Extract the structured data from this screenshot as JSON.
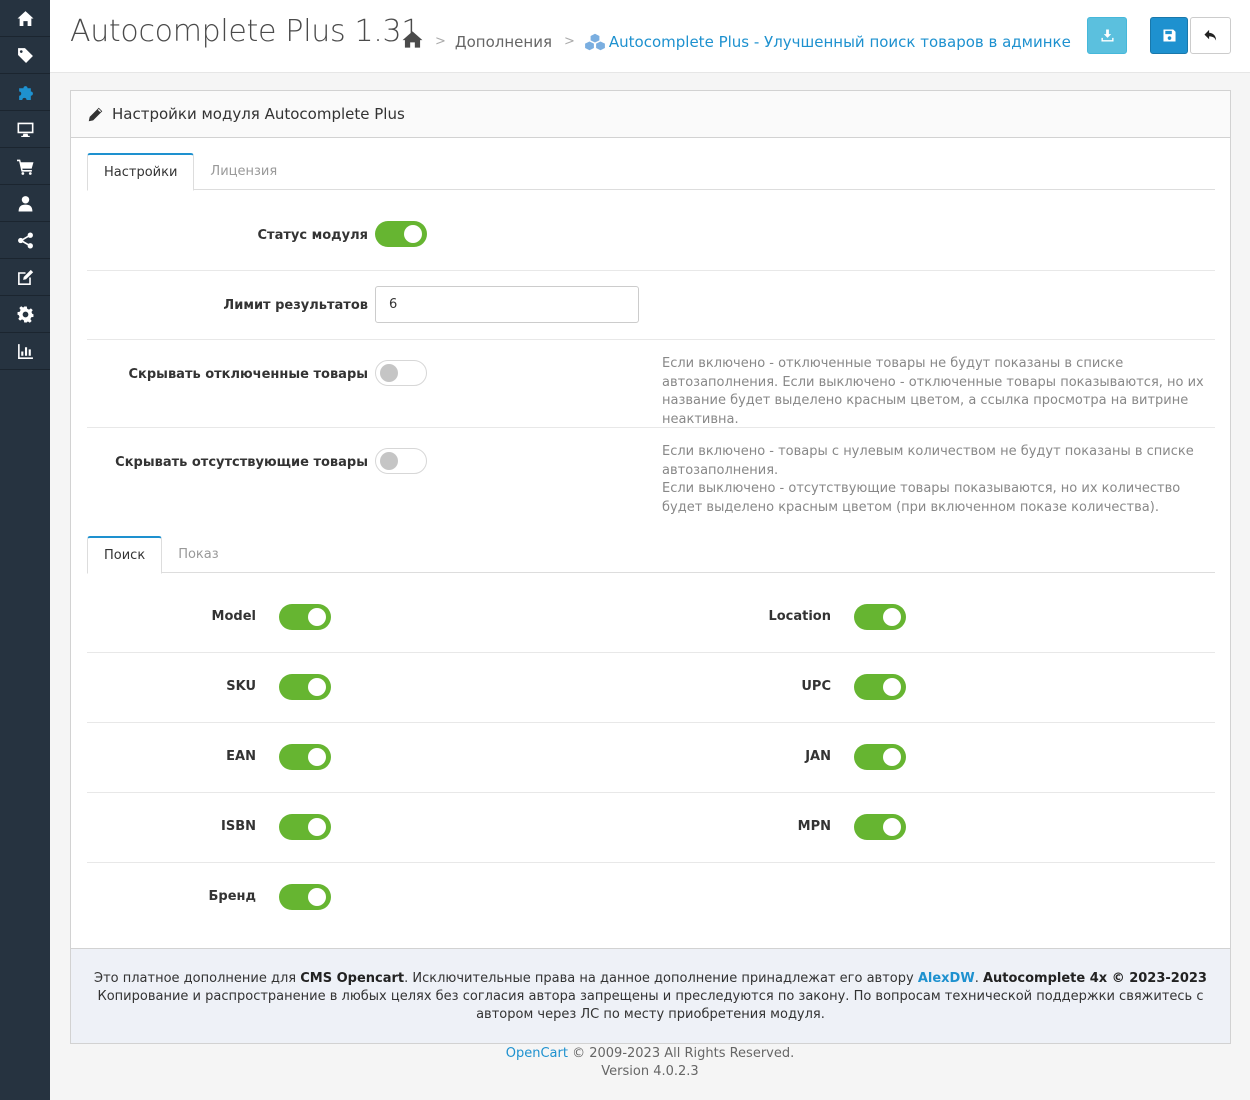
{
  "sidebar": {
    "items": [
      {
        "icon": "home-icon"
      },
      {
        "icon": "tag-icon"
      },
      {
        "icon": "puzzle-icon"
      },
      {
        "icon": "desktop-icon"
      },
      {
        "icon": "cart-icon"
      },
      {
        "icon": "user-icon"
      },
      {
        "icon": "share-icon"
      },
      {
        "icon": "edit-icon"
      },
      {
        "icon": "cog-icon"
      },
      {
        "icon": "bar-chart-icon"
      }
    ],
    "active_color": "#1e91cf"
  },
  "header": {
    "title": "Autocomplete Plus 1.31",
    "breadcrumb": {
      "sep": ">",
      "level1": "Дополнения",
      "level2": "Autocomplete Plus - Улучшенный поиск товаров в админке"
    }
  },
  "panel": {
    "heading": "Настройки модуля Autocomplete Plus",
    "tabs": [
      "Настройки",
      "Лицензия"
    ],
    "status_label": "Статус модуля",
    "status_on": true,
    "limit_label": "Лимит результатов",
    "limit_value": "6",
    "hide_disabled_label": "Скрывать отключенные товары",
    "hide_disabled_on": false,
    "hide_disabled_help": "Если включено - отключенные товары не будут показаны в списке автозаполнения. Если выключено - отключенные товары показываются, но их название будет выделено красным цветом, а ссылка просмотра на витрине неактивна.",
    "hide_missing_label": "Скрывать отсутствующие товары",
    "hide_missing_on": false,
    "hide_missing_help_1": "Если включено - товары с нулевым количеством не будут показаны в списке автозаполнения.",
    "hide_missing_help_2": "Если выключено - отсутствующие товары показываются, но их количество будет выделено красным цветом (при включенном показе количества).",
    "subtabs": [
      "Поиск",
      "Показ"
    ],
    "search_fields_left": [
      "Model",
      "SKU",
      "EAN",
      "ISBN",
      "Бренд"
    ],
    "search_fields_right": [
      "Location",
      "UPC",
      "JAN",
      "MPN"
    ]
  },
  "note": {
    "p1": "Это платное дополнение для ",
    "cms": "CMS Opencart",
    "p2": ". Исключительные права на данное дополнение принадлежат его автору ",
    "author": "AlexDW",
    "p3": ". ",
    "product": "Autocomplete 4x © 2023-2023",
    "line2": "Копирование и распространение в любых целях без согласия автора запрещены и преследуются по закону. По вопросам технической поддержки свяжитесь с автором через ЛС по месту приобретения модуля."
  },
  "footer": {
    "brand": "OpenCart",
    "copy": " © 2009-2023 All Rights Reserved.",
    "version": "Version 4.0.2.3"
  },
  "colors": {
    "primary": "#1e91cf",
    "toggle_on": "#66b531",
    "sidebar_bg": "#263340"
  }
}
